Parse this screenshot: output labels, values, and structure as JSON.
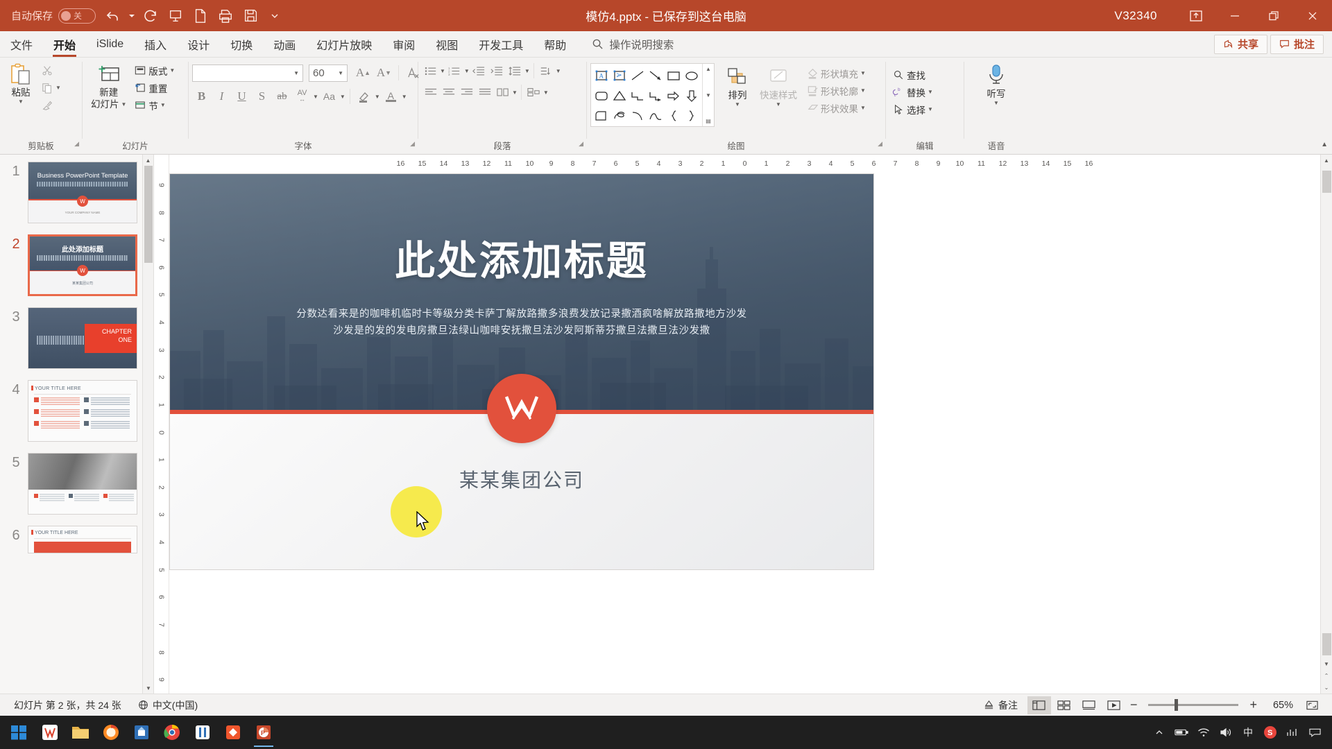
{
  "titlebar": {
    "autosave_label": "自动保存",
    "autosave_state": "关",
    "document_title": "模仿4.pptx  -  已保存到这台电脑",
    "version_label": "V32340",
    "quick_access": [
      {
        "name": "undo-icon",
        "label": "撤销"
      },
      {
        "name": "redo-icon",
        "label": "恢复"
      },
      {
        "name": "present-icon",
        "label": "从头开始"
      },
      {
        "name": "new-file-icon",
        "label": "新建"
      },
      {
        "name": "print-icon",
        "label": "打印"
      },
      {
        "name": "save-icon",
        "label": "保存"
      },
      {
        "name": "customize-caret-icon",
        "label": "自定义快速访问工具栏"
      }
    ],
    "window_buttons": [
      {
        "name": "ribbon-display-options-icon",
        "label": "功能区显示选项"
      },
      {
        "name": "minimize-icon",
        "label": "最小化"
      },
      {
        "name": "restore-icon",
        "label": "向下还原"
      },
      {
        "name": "close-icon",
        "label": "关闭"
      }
    ]
  },
  "tabs": [
    {
      "label": "文件",
      "active": false
    },
    {
      "label": "开始",
      "active": true
    },
    {
      "label": "iSlide",
      "active": false
    },
    {
      "label": "插入",
      "active": false
    },
    {
      "label": "设计",
      "active": false
    },
    {
      "label": "切换",
      "active": false
    },
    {
      "label": "动画",
      "active": false
    },
    {
      "label": "幻灯片放映",
      "active": false
    },
    {
      "label": "审阅",
      "active": false
    },
    {
      "label": "视图",
      "active": false
    },
    {
      "label": "开发工具",
      "active": false
    },
    {
      "label": "帮助",
      "active": false
    }
  ],
  "tellme": {
    "placeholder": "操作说明搜索"
  },
  "tab_right": {
    "share_label": "共享",
    "comment_label": "批注"
  },
  "ribbon": {
    "groups": [
      {
        "name": "clipboard",
        "label": "剪贴板"
      },
      {
        "name": "slides",
        "label": "幻灯片"
      },
      {
        "name": "font",
        "label": "字体"
      },
      {
        "name": "paragraph",
        "label": "段落"
      },
      {
        "name": "drawing",
        "label": "绘图"
      },
      {
        "name": "editing",
        "label": "编辑"
      },
      {
        "name": "voice",
        "label": "语音"
      }
    ],
    "clipboard": {
      "paste_label": "粘贴",
      "cut_label": "剪切",
      "copy_label": "复制",
      "format_painter_label": "格式刷"
    },
    "slides": {
      "new_slide_label_1": "新建",
      "new_slide_label_2": "幻灯片",
      "layout_label": "版式",
      "reset_label": "重置",
      "section_label": "节"
    },
    "font": {
      "font_name_value": "",
      "font_size_value": "60",
      "grow_font": "A",
      "shrink_font": "A",
      "clear_format": "清除所有格式",
      "bold": "B",
      "italic": "I",
      "underline": "U",
      "shadow": "S",
      "strikethrough": "ab",
      "char_spacing": "AV",
      "change_case": "Aa",
      "highlight": "文本突出显示颜色",
      "font_color": "A"
    },
    "drawing": {
      "arrange_label": "排列",
      "quick_styles_label": "快速样式",
      "shape_fill_label": "形状填充",
      "shape_outline_label": "形状轮廓",
      "shape_effects_label": "形状效果"
    },
    "editing": {
      "find_label": "查找",
      "replace_label": "替换",
      "select_label": "选择"
    },
    "voice": {
      "dictate_label": "听写"
    }
  },
  "thumbnails": [
    {
      "num": "1",
      "selected": false,
      "kind": "title",
      "title": "Business PowerPoint Template",
      "subtitle": "YOUR COMPANY NAME"
    },
    {
      "num": "2",
      "selected": true,
      "kind": "title-cn",
      "title": "此处添加标题",
      "subtitle": "某某集团公司"
    },
    {
      "num": "3",
      "selected": false,
      "kind": "chapter",
      "title_line1": "CHAPTER",
      "title_line2": "ONE"
    },
    {
      "num": "4",
      "selected": false,
      "kind": "sixbox",
      "title": "YOUR TITLE HERE"
    },
    {
      "num": "5",
      "selected": false,
      "kind": "photo",
      "title": ""
    },
    {
      "num": "6",
      "selected": false,
      "kind": "sixbox",
      "title": "YOUR TITLE HERE"
    }
  ],
  "ruler": {
    "horizontal": [
      "16",
      "15",
      "14",
      "13",
      "12",
      "11",
      "10",
      "9",
      "8",
      "7",
      "6",
      "5",
      "4",
      "3",
      "2",
      "1",
      "0",
      "1",
      "2",
      "3",
      "4",
      "5",
      "6",
      "7",
      "8",
      "9",
      "10",
      "11",
      "12",
      "13",
      "14",
      "15",
      "16"
    ],
    "vertical": [
      "9",
      "8",
      "7",
      "6",
      "5",
      "4",
      "3",
      "2",
      "1",
      "0",
      "1",
      "2",
      "3",
      "4",
      "5",
      "6",
      "7",
      "8",
      "9"
    ]
  },
  "slide": {
    "title": "此处添加标题",
    "subtitle_line1": "分数达看来是的咖啡机临时卡等级分类卡萨丁解放路撒多浪费发放记录撒酒疯啥解放路撒地方沙发",
    "subtitle_line2": "沙发是的发的发电房撒旦法绿山咖啡安抚撒旦法沙发阿斯蒂芬撒旦法撒旦法沙发撒",
    "company": "某某集团公司",
    "logo_letter": "W",
    "accent_color": "#e2513c",
    "hero_color": "#435568"
  },
  "statusbar": {
    "slide_counter": "幻灯片 第 2 张，共 24 张",
    "language": "中文(中国)",
    "notes_label": "备注",
    "views": [
      {
        "name": "normal-view-button",
        "active": true
      },
      {
        "name": "slide-sorter-view-button",
        "active": false
      },
      {
        "name": "reading-view-button",
        "active": false
      },
      {
        "name": "slideshow-view-button",
        "active": false
      }
    ],
    "zoom_out": "−",
    "zoom_in": "+",
    "zoom_value": "65%"
  },
  "taskbar": {
    "items": [
      {
        "name": "start-button",
        "label": "开始"
      },
      {
        "name": "taskbar-app-wps",
        "label": "WPS"
      },
      {
        "name": "taskbar-app-explorer",
        "label": "文件资源管理器"
      },
      {
        "name": "taskbar-app-firefox",
        "label": "Firefox"
      },
      {
        "name": "taskbar-app-store",
        "label": "应用商店"
      },
      {
        "name": "taskbar-app-chrome",
        "label": "Chrome"
      },
      {
        "name": "taskbar-app-music",
        "label": "音乐"
      },
      {
        "name": "taskbar-app-editor",
        "label": "编辑器"
      },
      {
        "name": "taskbar-app-powerpoint",
        "label": "PowerPoint",
        "active": true
      }
    ],
    "tray": [
      {
        "name": "tray-expand-icon",
        "label": "显示隐藏的图标"
      },
      {
        "name": "tray-battery-icon",
        "label": "电池"
      },
      {
        "name": "tray-network-icon",
        "label": "网络"
      },
      {
        "name": "tray-volume-icon",
        "label": "音量"
      },
      {
        "name": "tray-ime-icon",
        "label": "中"
      },
      {
        "name": "tray-sogou-icon",
        "label": "S"
      },
      {
        "name": "tray-stats-icon",
        "label": "统计"
      },
      {
        "name": "tray-notification-icon",
        "label": "通知"
      }
    ]
  }
}
